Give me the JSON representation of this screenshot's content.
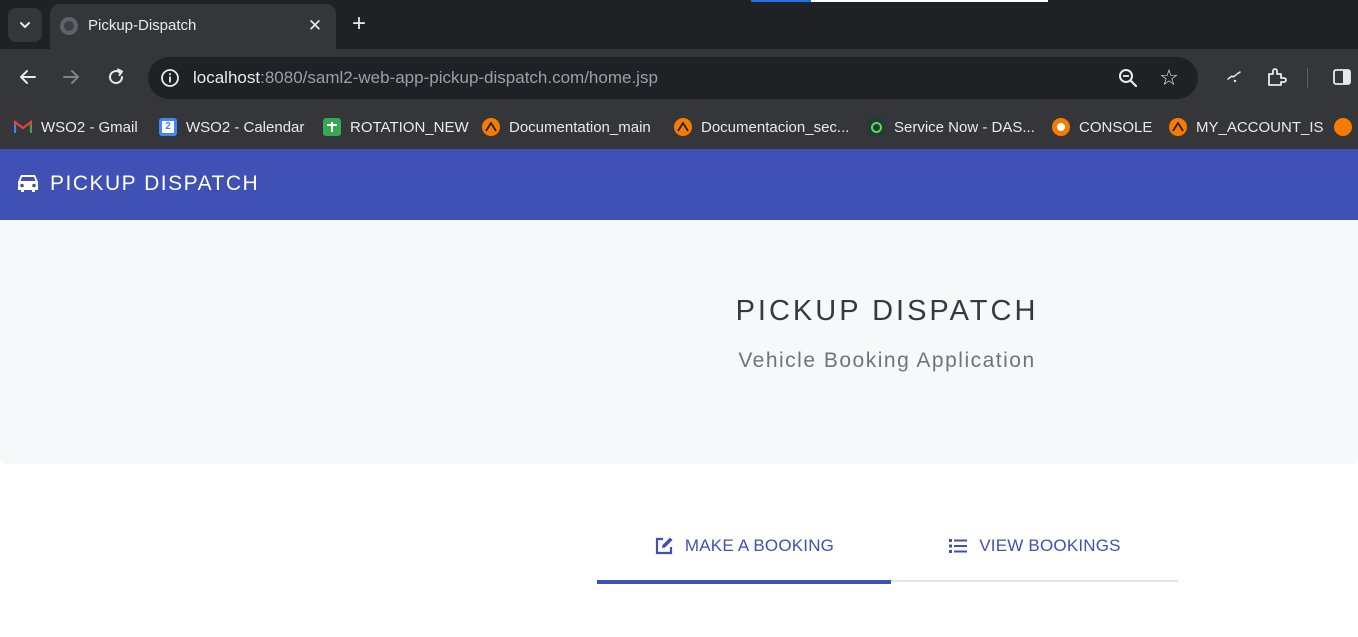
{
  "browser": {
    "tab": {
      "title": "Pickup-Dispatch",
      "close_glyph": "✕"
    },
    "new_tab_glyph": "+",
    "url": {
      "host": "localhost",
      "path": ":8080/saml2-web-app-pickup-dispatch.com/home.jsp"
    },
    "star_glyph": "☆",
    "bookmarks": [
      {
        "label": "WSO2 - Gmail",
        "icon": "gmail-icon",
        "color": "#ea4335"
      },
      {
        "label": "WSO2 - Calendar",
        "icon": "calendar-icon",
        "color": "#4285f4"
      },
      {
        "label": "ROTATION_NEW",
        "icon": "sheets-icon",
        "color": "#34a853"
      },
      {
        "label": "Documentation_main",
        "icon": "confluence-icon",
        "color": "#f57c00"
      },
      {
        "label": "Documentacion_sec...",
        "icon": "confluence-icon",
        "color": "#f57c00"
      },
      {
        "label": "Service Now - DAS...",
        "icon": "servicenow-icon",
        "color": "#62d84e"
      },
      {
        "label": "CONSOLE",
        "icon": "console-icon",
        "color": "#f57c00"
      },
      {
        "label": "MY_ACCOUNT_IS",
        "icon": "confluence-icon",
        "color": "#f57c00"
      }
    ]
  },
  "app": {
    "brand": "PICKUP DISPATCH",
    "hero": {
      "title": "PICKUP DISPATCH",
      "subtitle": "Vehicle Booking Application"
    },
    "tabs": [
      {
        "label": "MAKE A BOOKING",
        "icon": "edit-icon",
        "active": true
      },
      {
        "label": "VIEW BOOKINGS",
        "icon": "list-icon",
        "active": false
      }
    ],
    "colors": {
      "primary": "#3f51b5",
      "hero_bg": "#f7f8fa"
    }
  }
}
